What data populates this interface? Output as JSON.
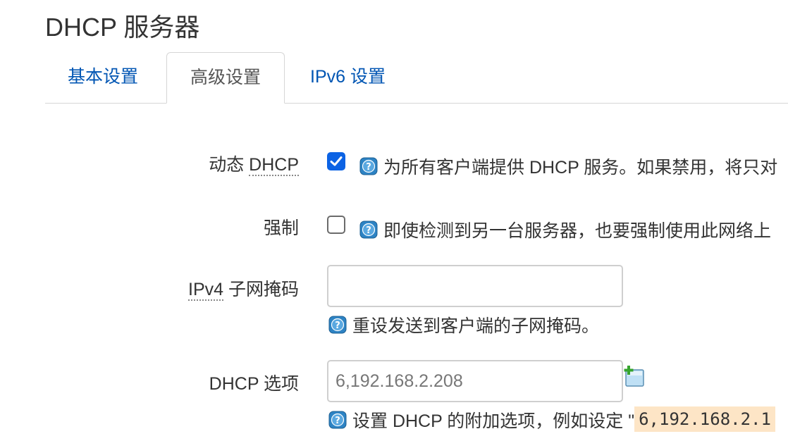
{
  "title": "DHCP 服务器",
  "tabs": [
    {
      "label": "基本设置",
      "active": false
    },
    {
      "label": "高级设置",
      "active": true
    },
    {
      "label": "IPv6 设置",
      "active": false
    }
  ],
  "rows": {
    "dynamic_dhcp": {
      "label_prefix": "动态 ",
      "label_abbr": "DHCP",
      "checked": true,
      "help": "为所有客户端提供 DHCP 服务。如果禁用，将只对"
    },
    "force": {
      "label": "强制",
      "checked": false,
      "help": "即使检测到另一台服务器，也要强制使用此网络上"
    },
    "netmask": {
      "label_abbr": "IPv4",
      "label_suffix": " 子网掩码",
      "value": "",
      "help": "重设发送到客户端的子网掩码。"
    },
    "dhcp_options": {
      "label": "DHCP 选项",
      "placeholder": "6,192.168.2.208",
      "help_prefix": "设置 DHCP 的附加选项，例如设定 \"",
      "help_code": "6,192.168.2.1"
    }
  },
  "icons": {
    "help": "question-mark-icon",
    "add": "add-item-icon"
  },
  "colors": {
    "link": "#0055b3",
    "checkbox_checked": "#0c63e4",
    "code_bg": "#fde5c6",
    "help_icon": "#2d83c4"
  }
}
